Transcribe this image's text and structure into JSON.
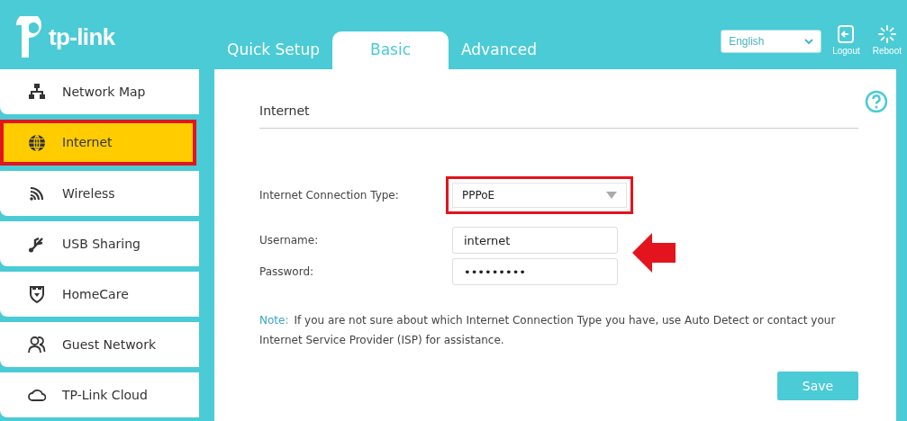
{
  "brand": "tp-link",
  "tabs": [
    {
      "label": "Quick Setup",
      "selected": false
    },
    {
      "label": "Basic",
      "selected": true
    },
    {
      "label": "Advanced",
      "selected": false
    }
  ],
  "language": {
    "value": "English"
  },
  "header_buttons": [
    {
      "kind": "logout",
      "label": "Logout"
    },
    {
      "kind": "reboot",
      "label": "Reboot"
    }
  ],
  "sidebar": {
    "items": [
      {
        "kind": "map",
        "label": "Network Map",
        "selected": false
      },
      {
        "kind": "globe",
        "label": "Internet",
        "selected": true
      },
      {
        "kind": "wifi",
        "label": "Wireless",
        "selected": false
      },
      {
        "kind": "usb",
        "label": "USB Sharing",
        "selected": false
      },
      {
        "kind": "shield",
        "label": "HomeCare",
        "selected": false
      },
      {
        "kind": "people",
        "label": "Guest Network",
        "selected": false
      },
      {
        "kind": "cloud",
        "label": "TP-Link Cloud",
        "selected": false
      }
    ]
  },
  "panel": {
    "title": "Internet",
    "connection_type": {
      "label": "Internet Connection Type:",
      "value": "PPPoE",
      "highlighted": true
    },
    "username": {
      "label": "Username:",
      "value": "internet"
    },
    "password": {
      "label": "Password:",
      "value": "•••••••••"
    },
    "note": {
      "label": "Note:",
      "text": "If you are not sure about which Internet Connection Type you have, use Auto Detect or contact your Internet Service Provider (ISP) for assistance."
    },
    "save_button": "Save"
  }
}
